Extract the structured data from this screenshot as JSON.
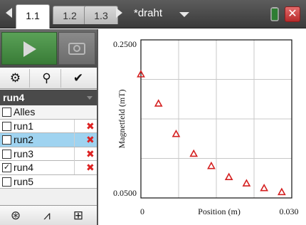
{
  "topbar": {
    "tabs": [
      {
        "label": "1.1",
        "active": true
      },
      {
        "label": "1.2",
        "active": false
      },
      {
        "label": "1.3",
        "active": false
      }
    ],
    "document_title": "*draht",
    "icons": [
      "nav-left-icon",
      "nav-right-icon",
      "dropdown-icon",
      "battery-icon",
      "close-icon"
    ],
    "close_label": "✕"
  },
  "capture": {
    "start_icon": "play-icon",
    "camera_icon": "camera-icon"
  },
  "tools": {
    "settings_icon": "⚙",
    "marker_icon": "⚲",
    "check_icon": "✔"
  },
  "run_selector": {
    "value": "run4"
  },
  "run_list": {
    "alles_label": "Alles",
    "runs": [
      {
        "label": "run1",
        "checked": false,
        "deletable": true,
        "selected": false
      },
      {
        "label": "run2",
        "checked": false,
        "deletable": true,
        "selected": true
      },
      {
        "label": "run3",
        "checked": false,
        "deletable": true,
        "selected": false
      },
      {
        "label": "run4",
        "checked": true,
        "deletable": true,
        "selected": false
      },
      {
        "label": "run5",
        "checked": false,
        "deletable": false,
        "selected": false
      }
    ],
    "delete_mark": "✖",
    "check_mark": "✓"
  },
  "view_bar": {
    "meter_icon": "⊛",
    "graph_icon": "⩘",
    "table_icon": "⊞"
  },
  "colors": {
    "marker": "#d42020",
    "selected_row": "#9fd3f0",
    "start_button": "#4a8f48"
  },
  "chart_data": {
    "type": "scatter",
    "title": "",
    "xlabel": "Position (m)",
    "ylabel": "Magnetfeld (mT)",
    "xlim": [
      0,
      0.03
    ],
    "ylim": [
      0.05,
      0.25
    ],
    "x_tick_labels": [
      "0",
      "0.030"
    ],
    "y_tick_labels": [
      "0.2500",
      "0.0500"
    ],
    "grid": true,
    "marker": "triangle",
    "series": [
      {
        "x": [
          0.0,
          0.0035,
          0.007,
          0.0105,
          0.014,
          0.0175,
          0.021,
          0.0245,
          0.028
        ],
        "y": [
          0.2065,
          0.1695,
          0.131,
          0.106,
          0.0905,
          0.0765,
          0.0685,
          0.0625,
          0.0575
        ]
      }
    ]
  }
}
